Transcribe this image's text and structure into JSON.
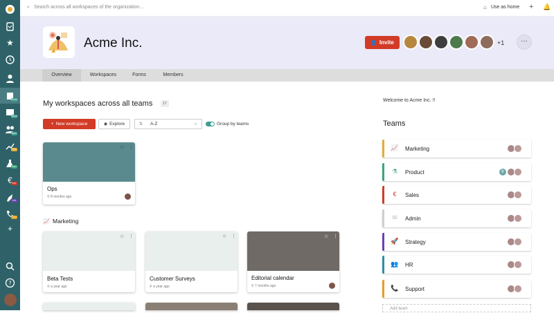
{
  "topbar": {
    "search_placeholder": "Search across all workspaces of the organization...",
    "use_as_home": "Use as home",
    "add_symbol": "+"
  },
  "rail": {
    "items": [
      {
        "icon": "org-logo-icon"
      },
      {
        "icon": "clipboard-icon"
      },
      {
        "icon": "star-icon"
      },
      {
        "icon": "clock-icon"
      },
      {
        "icon": "user-icon"
      },
      {
        "icon": "building-icon",
        "badge": "DEMO"
      },
      {
        "icon": "inbox-icon",
        "badge": "INBOX"
      },
      {
        "icon": "team-icon",
        "badge": "NEW"
      },
      {
        "icon": "chart-icon",
        "badge": "MKT"
      },
      {
        "icon": "flask-icon",
        "badge": "PRD"
      },
      {
        "icon": "euro-icon",
        "badge": "SAL"
      },
      {
        "icon": "rocket-icon",
        "badge": "STR"
      },
      {
        "icon": "phone-icon",
        "badge": "SUP"
      },
      {
        "icon": "plus-icon"
      },
      {
        "icon": "search-icon"
      },
      {
        "icon": "help-icon"
      },
      {
        "icon": "avatar-icon"
      }
    ]
  },
  "header": {
    "org_name": "Acme Inc.",
    "invite_label": "Invite",
    "extra_members": "+1",
    "more_label": "···"
  },
  "tabs": [
    {
      "label": "Overview",
      "active": true
    },
    {
      "label": "Workspaces",
      "active": false
    },
    {
      "label": "Forms",
      "active": false
    },
    {
      "label": "Members",
      "active": false
    }
  ],
  "main": {
    "section_title": "My workspaces across all teams",
    "workspace_count": "17",
    "new_workspace_label": "New workspace",
    "explore_label": "Explore",
    "sort_value": "A-Z",
    "group_by_teams_label": "Group by teams",
    "group_by_teams_on": true,
    "cards_top": [
      {
        "title": "Ops",
        "meta": "8 months ago",
        "cover_color": "#5b8a8e"
      }
    ],
    "group_marketing": {
      "label": "Marketing",
      "cards": [
        {
          "title": "Beta Tests",
          "meta": "a year ago",
          "cover_color": "#e9efed"
        },
        {
          "title": "Customer Surveys",
          "meta": "a year ago",
          "cover_color": "#e9efed"
        },
        {
          "title": "Editorial calendar",
          "meta": "7 months ago",
          "cover_color": "#6f6a66"
        }
      ]
    }
  },
  "sidebar": {
    "welcome": "Welcome to Acme Inc. !!",
    "teams_heading": "Teams",
    "teams": [
      {
        "name": "Marketing",
        "color": "#e5ac35",
        "icon": "chart-icon",
        "glyph": "📈"
      },
      {
        "name": "Product",
        "color": "#3ba77a",
        "icon": "flask-icon",
        "glyph": "⚗"
      },
      {
        "name": "Sales",
        "color": "#d23b26",
        "icon": "euro-icon",
        "glyph": "€"
      },
      {
        "name": "Admin",
        "color": "#cfcfcf",
        "icon": "mail-icon",
        "glyph": "✉"
      },
      {
        "name": "Strategy",
        "color": "#6a3fb5",
        "icon": "rocket-icon",
        "glyph": "🚀"
      },
      {
        "name": "HR",
        "color": "#2f8fa6",
        "icon": "people-icon",
        "glyph": "👥"
      },
      {
        "name": "Support",
        "color": "#e5a021",
        "icon": "phone-icon",
        "glyph": "📞"
      }
    ],
    "add_team_label": "Add team"
  }
}
